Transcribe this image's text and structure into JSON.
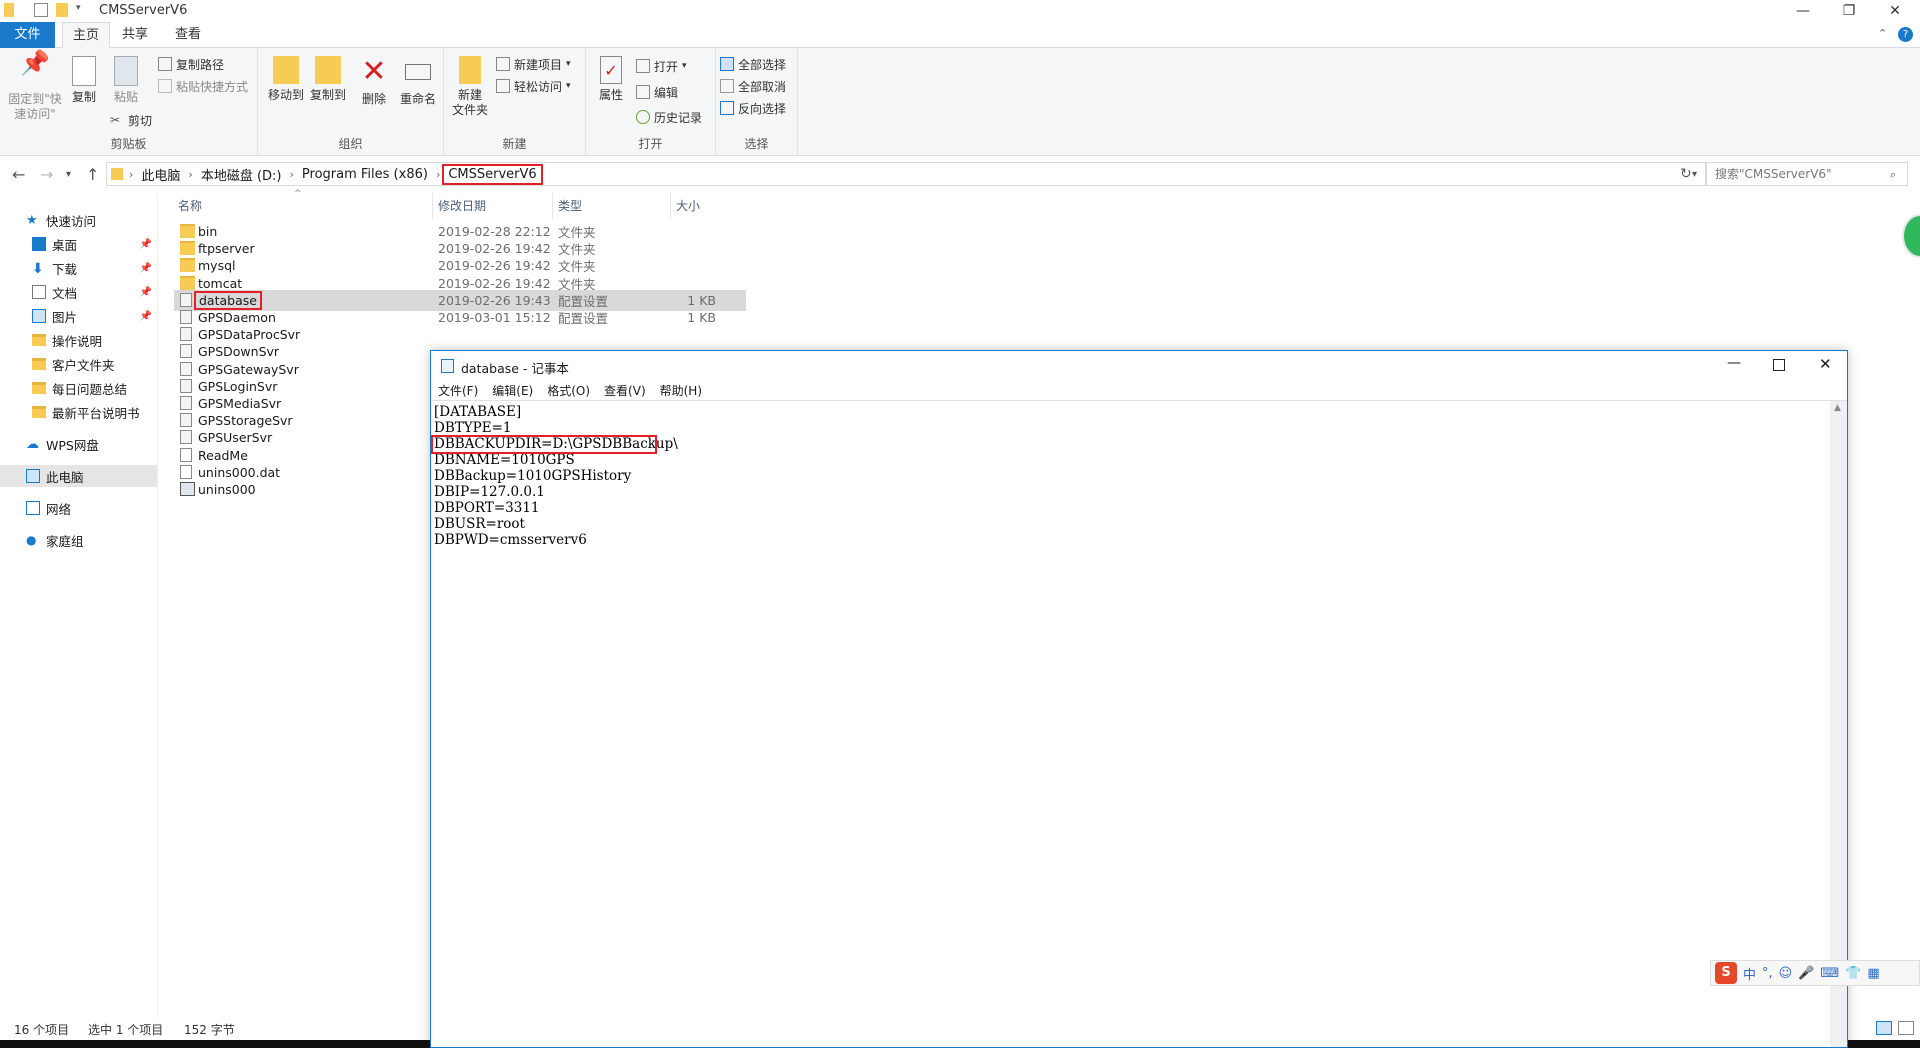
{
  "window": {
    "title": "CMSServerV6"
  },
  "tabs": [
    {
      "label": "文件"
    },
    {
      "label": "主页"
    },
    {
      "label": "共享"
    },
    {
      "label": "查看"
    }
  ],
  "ribbon": {
    "clipboard": {
      "label": "剪贴板",
      "pin_label_1": "固定到\"快",
      "pin_label_2": "速访问\"",
      "copy": "复制",
      "paste": "粘贴",
      "copy_path": "复制路径",
      "paste_shortcut": "粘贴快捷方式",
      "cut": "剪切"
    },
    "organize": {
      "label": "组织",
      "move_to": "移动到",
      "copy_to": "复制到",
      "delete": "删除",
      "rename": "重命名"
    },
    "new": {
      "label": "新建",
      "new_folder_1": "新建",
      "new_folder_2": "文件夹",
      "new_item": "新建项目",
      "easy_access": "轻松访问"
    },
    "open": {
      "label": "打开",
      "properties": "属性",
      "open": "打开",
      "edit": "编辑",
      "history": "历史记录"
    },
    "select": {
      "label": "选择",
      "select_all": "全部选择",
      "select_none": "全部取消",
      "invert": "反向选择"
    }
  },
  "address": {
    "crumbs": [
      "此电脑",
      "本地磁盘 (D:)",
      "Program Files (x86)",
      "CMSServerV6"
    ],
    "search_placeholder": "搜索\"CMSServerV6\""
  },
  "nav": {
    "quick_access": "快速访问",
    "items": [
      {
        "label": "桌面"
      },
      {
        "label": "下载"
      },
      {
        "label": "文档"
      },
      {
        "label": "图片"
      },
      {
        "label": "操作说明"
      },
      {
        "label": "客户文件夹"
      },
      {
        "label": "每日问题总结"
      },
      {
        "label": "最新平台说明书"
      }
    ],
    "wps": "WPS网盘",
    "this_pc": "此电脑",
    "network": "网络",
    "homegroup": "家庭组"
  },
  "filelist": {
    "columns": {
      "name": "名称",
      "date": "修改日期",
      "type": "类型",
      "size": "大小"
    },
    "rows": [
      {
        "name": "bin",
        "date": "2019-02-28 22:12",
        "type": "文件夹",
        "size": "",
        "kind": "folder"
      },
      {
        "name": "ftpserver",
        "date": "2019-02-26 19:42",
        "type": "文件夹",
        "size": "",
        "kind": "folder"
      },
      {
        "name": "mysql",
        "date": "2019-02-26 19:42",
        "type": "文件夹",
        "size": "",
        "kind": "folder"
      },
      {
        "name": "tomcat",
        "date": "2019-02-26 19:42",
        "type": "文件夹",
        "size": "",
        "kind": "folder"
      },
      {
        "name": "database",
        "date": "2019-02-26 19:43",
        "type": "配置设置",
        "size": "1 KB",
        "kind": "config"
      },
      {
        "name": "GPSDaemon",
        "date": "2019-03-01 15:12",
        "type": "配置设置",
        "size": "1 KB",
        "kind": "config"
      },
      {
        "name": "GPSDataProcSvr",
        "date": "",
        "type": "",
        "size": "",
        "kind": "config"
      },
      {
        "name": "GPSDownSvr",
        "date": "",
        "type": "",
        "size": "",
        "kind": "config"
      },
      {
        "name": "GPSGatewaySvr",
        "date": "",
        "type": "",
        "size": "",
        "kind": "config"
      },
      {
        "name": "GPSLoginSvr",
        "date": "",
        "type": "",
        "size": "",
        "kind": "config"
      },
      {
        "name": "GPSMediaSvr",
        "date": "",
        "type": "",
        "size": "",
        "kind": "config"
      },
      {
        "name": "GPSStorageSvr",
        "date": "",
        "type": "",
        "size": "",
        "kind": "config"
      },
      {
        "name": "GPSUserSvr",
        "date": "",
        "type": "",
        "size": "",
        "kind": "config"
      },
      {
        "name": "ReadMe",
        "date": "",
        "type": "",
        "size": "",
        "kind": "text"
      },
      {
        "name": "unins000.dat",
        "date": "",
        "type": "",
        "size": "",
        "kind": "file"
      },
      {
        "name": "unins000",
        "date": "",
        "type": "",
        "size": "",
        "kind": "exe"
      }
    ]
  },
  "status": {
    "count": "16 个项目",
    "selected": "选中 1 个项目",
    "size": "152 字节"
  },
  "notepad": {
    "title": "database - 记事本",
    "menu": [
      "文件(F)",
      "编辑(E)",
      "格式(O)",
      "查看(V)",
      "帮助(H)"
    ],
    "lines": [
      "[DATABASE]",
      "DBTYPE=1",
      "DBBACKUPDIR=D:\\GPSDBBackup\\",
      "DBNAME=1010GPS",
      "DBBackup=1010GPSHistory",
      "DBIP=127.0.0.1",
      "DBPORT=3311",
      "DBUSR=root",
      "DBPWD=cmsserverv6"
    ]
  },
  "ime": {
    "label": "中"
  },
  "colors": {
    "accent": "#1979ca",
    "highlight": "#e0202a",
    "folder": "#f6cc55"
  }
}
